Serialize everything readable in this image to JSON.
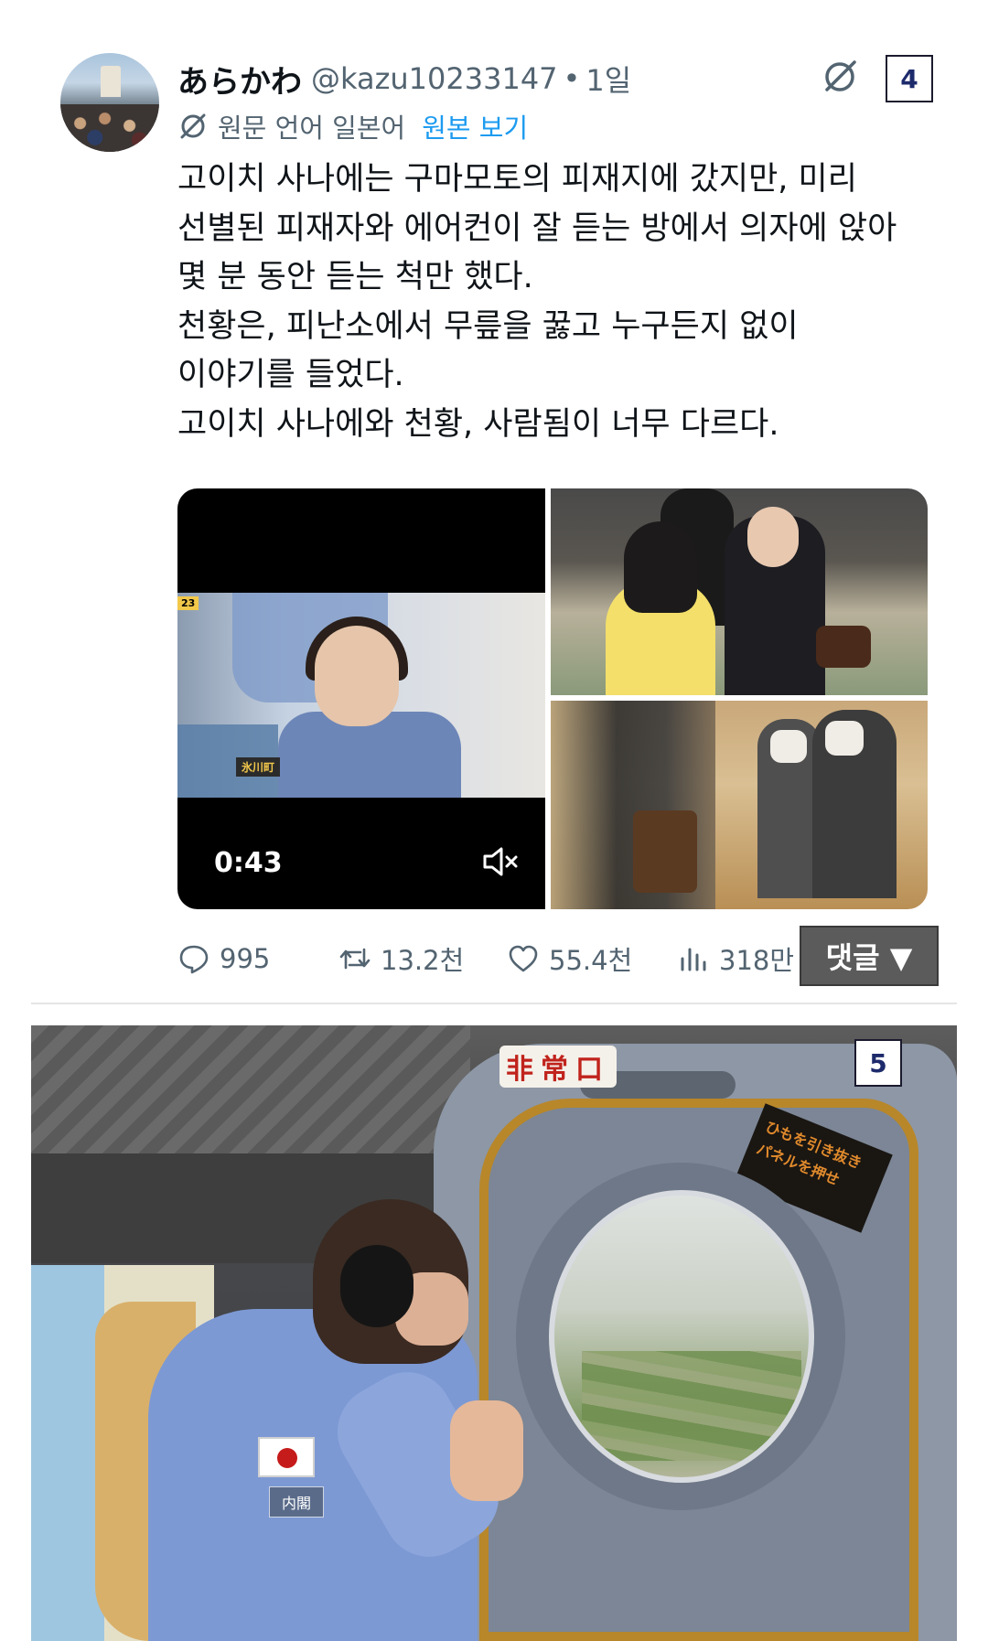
{
  "tweet": {
    "display_name": "あらかわ",
    "handle": "@kazu10233147",
    "separator": "•",
    "time": "1일",
    "badge_number": "4",
    "translation": {
      "label": "원문 언어 일본어",
      "show_original": "원본 보기"
    },
    "text_lines": [
      "고이치 사나에는 구마모토의 피재지에 갔지만, 미리",
      "선별된 피재자와 에어컨이 잘 듣는 방에서 의자에 앉아",
      "몇 분 동안 듣는 척만 했다.",
      "천황은, 피난소에서 무릎을 꿇고 누구든지 없이",
      "이야기를 들었다.",
      "고이치 사나에와 천황, 사람됨이 너무 다르다."
    ],
    "media": {
      "video_duration": "0:43",
      "video_caption": "氷川町",
      "video_tag": "23"
    },
    "actions": {
      "replies": "995",
      "retweets": "13.2천",
      "likes": "55.4천",
      "views": "318만"
    },
    "comment_button": "댓글 ▼"
  },
  "second_item": {
    "badge_number": "5",
    "sign_text": "非常口",
    "door_label": "ひもを引き抜き パネルを押せ",
    "patch_text": "内閣"
  },
  "colors": {
    "link": "#1d9bf0",
    "muted": "#536471",
    "text": "#0f1419"
  }
}
